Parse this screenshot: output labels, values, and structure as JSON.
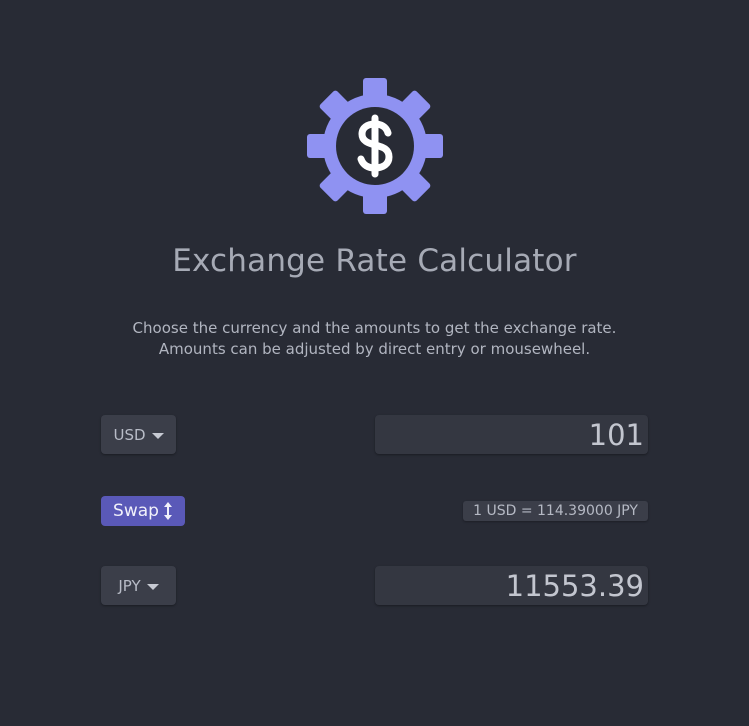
{
  "app": {
    "title": "Exchange Rate Calculator",
    "description_line1": "Choose the currency and the amounts to get the exchange rate.",
    "description_line2": "Amounts can be adjusted by direct entry or mousewheel.",
    "logo_icon": "gear-dollar-icon",
    "accent_color": "#8f92f2"
  },
  "currency_one": {
    "code": "USD",
    "amount": "101"
  },
  "swap": {
    "label": "Swap",
    "icon": "up-down-arrow-icon",
    "color": "#5a59b8"
  },
  "rate": {
    "text": "1 USD = 114.39000 JPY"
  },
  "currency_two": {
    "code": "JPY",
    "amount": "11553.39"
  }
}
